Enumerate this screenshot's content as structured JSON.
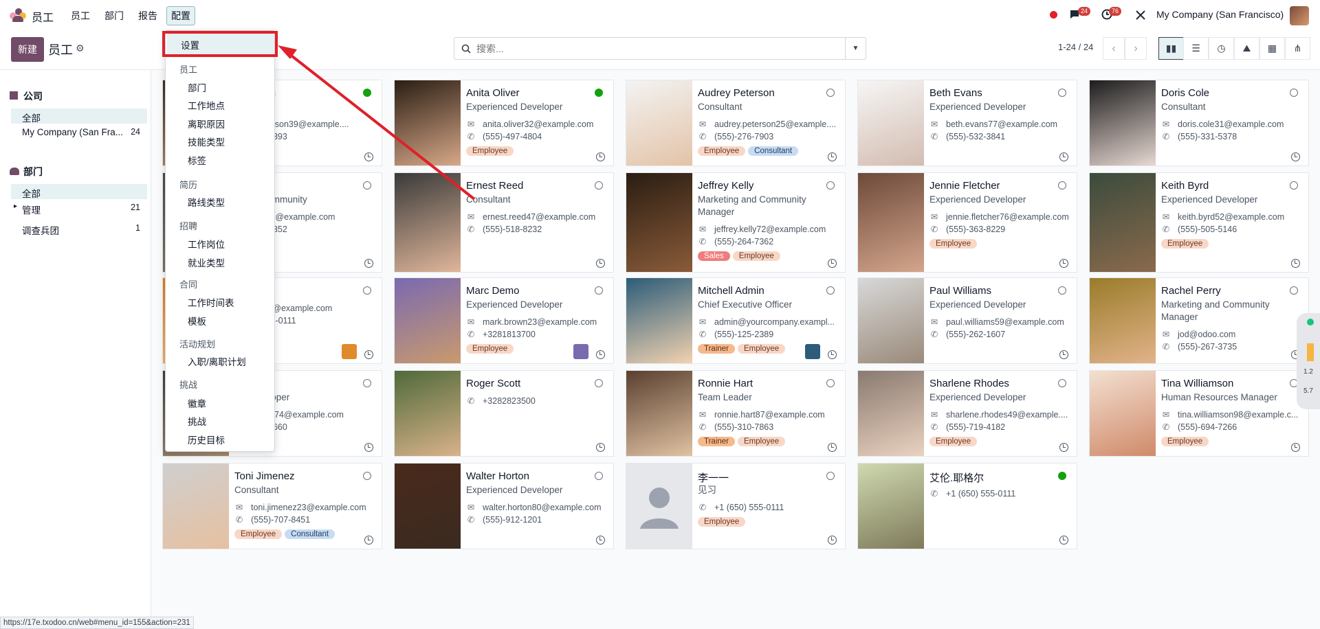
{
  "topbar": {
    "app_name": "员工",
    "nav": [
      "员工",
      "部门",
      "报告",
      "配置"
    ],
    "active_nav": "配置",
    "chat_badge": "24",
    "activity_badge": "76",
    "company": "My Company (San Francisco)"
  },
  "control": {
    "new_label": "新建",
    "title": "员工",
    "search_placeholder": "搜索...",
    "pager": "1-24 / 24"
  },
  "sidepanel": {
    "company_head": "公司",
    "company_items": [
      {
        "label": "全部",
        "count": ""
      },
      {
        "label": "My Company (San Fra...",
        "count": "24"
      }
    ],
    "dept_head": "部门",
    "dept_items": [
      {
        "label": "全部",
        "count": ""
      },
      {
        "label": "管理",
        "count": "21"
      },
      {
        "label": "调查兵团",
        "count": "1"
      }
    ]
  },
  "dropdown": {
    "first": "设置",
    "sections": [
      {
        "title": "员工",
        "items": [
          "部门",
          "工作地点",
          "离职原因",
          "技能类型",
          "标签"
        ]
      },
      {
        "title": "简历",
        "items": [
          "路线类型"
        ]
      },
      {
        "title": "招聘",
        "items": [
          "工作岗位",
          "就业类型"
        ]
      },
      {
        "title": "合同",
        "items": [
          "工作时间表",
          "模板"
        ]
      },
      {
        "title": "活动规划",
        "items": [
          "入职/离职计划"
        ]
      },
      {
        "title": "挑战",
        "items": [
          "徽章",
          "挑战",
          "历史目标"
        ]
      }
    ]
  },
  "cards": [
    {
      "name": "Peterson",
      "job": "nt",
      "email": "l.peterson39@example....",
      "phone": "233-3393",
      "tags": [],
      "status": "on"
    },
    {
      "name": "Anita Oliver",
      "job": "Experienced Developer",
      "email": "anita.oliver32@example.com",
      "phone": "(555)-497-4804",
      "tags": [
        "Employee"
      ],
      "status": "on"
    },
    {
      "name": "Audrey Peterson",
      "job": "Consultant",
      "email": "audrey.peterson25@example....",
      "phone": "(555)-276-7903",
      "tags": [
        "Employee",
        "Consultant"
      ],
      "status": "off"
    },
    {
      "name": "Beth Evans",
      "job": "Experienced Developer",
      "email": "beth.evans77@example.com",
      "phone": "(555)-532-3841",
      "tags": [],
      "status": "off"
    },
    {
      "name": "Doris Cole",
      "job": "Consultant",
      "email": "doris.cole31@example.com",
      "phone": "(555)-331-5378",
      "tags": [],
      "status": "off"
    },
    {
      "name": "ert",
      "job": "g and Community",
      "email": "bert22@example.com",
      "phone": "169-1352",
      "tags": [],
      "status": "off"
    },
    {
      "name": "Ernest Reed",
      "job": "Consultant",
      "email": "ernest.reed47@example.com",
      "phone": "(555)-518-8232",
      "tags": [],
      "status": "off"
    },
    {
      "name": "Jeffrey Kelly",
      "job": "Marketing and Community Manager",
      "email": "jeffrey.kelly72@example.com",
      "phone": "(555)-264-7362",
      "tags": [
        "Sales",
        "Employee"
      ],
      "status": "off"
    },
    {
      "name": "Jennie Fletcher",
      "job": "Experienced Developer",
      "email": "jennie.fletcher76@example.com",
      "phone": "(555)-363-8229",
      "tags": [
        "Employee"
      ],
      "status": "off"
    },
    {
      "name": "Keith Byrd",
      "job": "Experienced Developer",
      "email": "keith.byrd52@example.com",
      "phone": "(555)-505-5146",
      "tags": [
        "Employee"
      ],
      "status": "off"
    },
    {
      "name": "oiret",
      "job": "",
      "email": "poiret@example.com",
      "phone": "0) 555-0111",
      "tags": [],
      "status": "off"
    },
    {
      "name": "Marc Demo",
      "job": "Experienced Developer",
      "email": "mark.brown23@example.com",
      "phone": "+3281813700",
      "tags": [
        "Employee"
      ],
      "status": "off"
    },
    {
      "name": "Mitchell Admin",
      "job": "Chief Executive Officer",
      "email": "admin@yourcompany.exampl...",
      "phone": "(555)-125-2389",
      "tags": [
        "Trainer",
        "Employee"
      ],
      "status": "off"
    },
    {
      "name": "Paul Williams",
      "job": "Experienced Developer",
      "email": "paul.williams59@example.com",
      "phone": "(555)-262-1607",
      "tags": [],
      "status": "off"
    },
    {
      "name": "Rachel Perry",
      "job": "Marketing and Community Manager",
      "email": "jod@odoo.com",
      "phone": "(555)-267-3735",
      "tags": [],
      "status": "off"
    },
    {
      "name": "Lewis",
      "job": "ed Developer",
      "email": "l.lewis74@example.com",
      "phone": "775-6660",
      "tags": [],
      "status": "off"
    },
    {
      "name": "Roger Scott",
      "job": "",
      "email": "",
      "phone": "+3282823500",
      "tags": [],
      "status": "off"
    },
    {
      "name": "Ronnie Hart",
      "job": "Team Leader",
      "email": "ronnie.hart87@example.com",
      "phone": "(555)-310-7863",
      "tags": [
        "Trainer",
        "Employee"
      ],
      "status": "off"
    },
    {
      "name": "Sharlene Rhodes",
      "job": "Experienced Developer",
      "email": "sharlene.rhodes49@example....",
      "phone": "(555)-719-4182",
      "tags": [
        "Employee"
      ],
      "status": "off"
    },
    {
      "name": "Tina Williamson",
      "job": "Human Resources Manager",
      "email": "tina.williamson98@example.c...",
      "phone": "(555)-694-7266",
      "tags": [
        "Employee"
      ],
      "status": "off"
    },
    {
      "name": "Toni Jimenez",
      "job": "Consultant",
      "email": "toni.jimenez23@example.com",
      "phone": "(555)-707-8451",
      "tags": [
        "Employee",
        "Consultant"
      ],
      "status": "off"
    },
    {
      "name": "Walter Horton",
      "job": "Experienced Developer",
      "email": "walter.horton80@example.com",
      "phone": "(555)-912-1201",
      "tags": [],
      "status": "off"
    },
    {
      "name": "李一一",
      "job": "见习",
      "email": "",
      "phone": "+1 (650) 555-0111",
      "tags": [
        "Employee"
      ],
      "status": "off"
    },
    {
      "name": "艾伦.耶格尔",
      "job": "",
      "email": "",
      "phone": "+1 (650) 555-0111",
      "tags": [],
      "status": "on"
    }
  ],
  "status_url": "https://17e.txodoo.cn/web#menu_id=155&action=231",
  "widget": {
    "v1": "1.2",
    "v2": "5.7"
  }
}
